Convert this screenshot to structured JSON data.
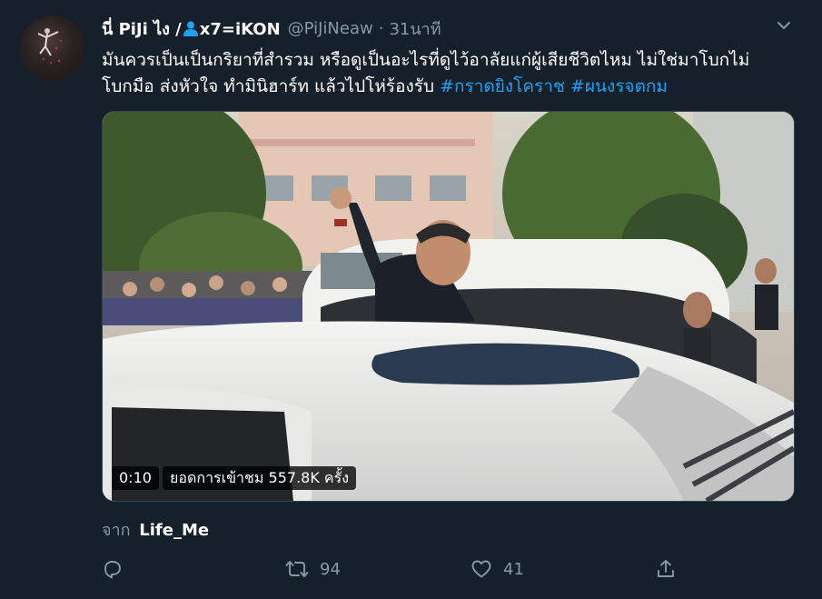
{
  "tweet": {
    "author_name": "นี่ PiJi ไง /",
    "author_name_icon": "person-icon",
    "author_name_suffix": "x7=iKON",
    "handle": "@PiJiNeaw",
    "separator": "·",
    "time": "31นาที",
    "text_main": "มันควรเป็นเป็นกริยาที่สำรวม หรือดูเป็นอะไรที่ดูไว้อาลัยแก่ผู้เสียชีวิตไหม ไม่ใช่มาโบกไม่โบกมือ ส่งหัวใจ ทำมินิฮาร์ท แล้วไปโห่ร้องรับ",
    "hashtags": [
      "#กราดยิงโคราช",
      "#ผนงรจตกม"
    ],
    "video": {
      "duration": "0:10",
      "views": "ยอดการเข้าชม 557.8K ครั้ง"
    },
    "source_prefix": "จาก",
    "source_name": "Life_Me",
    "actions": {
      "reply_icon": "reply-icon",
      "retweet_icon": "retweet-icon",
      "retweet_count": "94",
      "like_icon": "heart-icon",
      "like_count": "41",
      "share_icon": "share-icon"
    }
  },
  "colors": {
    "background": "#15202b",
    "accent": "#1da1f2",
    "secondary_text": "#8899a6",
    "primary_text": "#ffffff"
  }
}
